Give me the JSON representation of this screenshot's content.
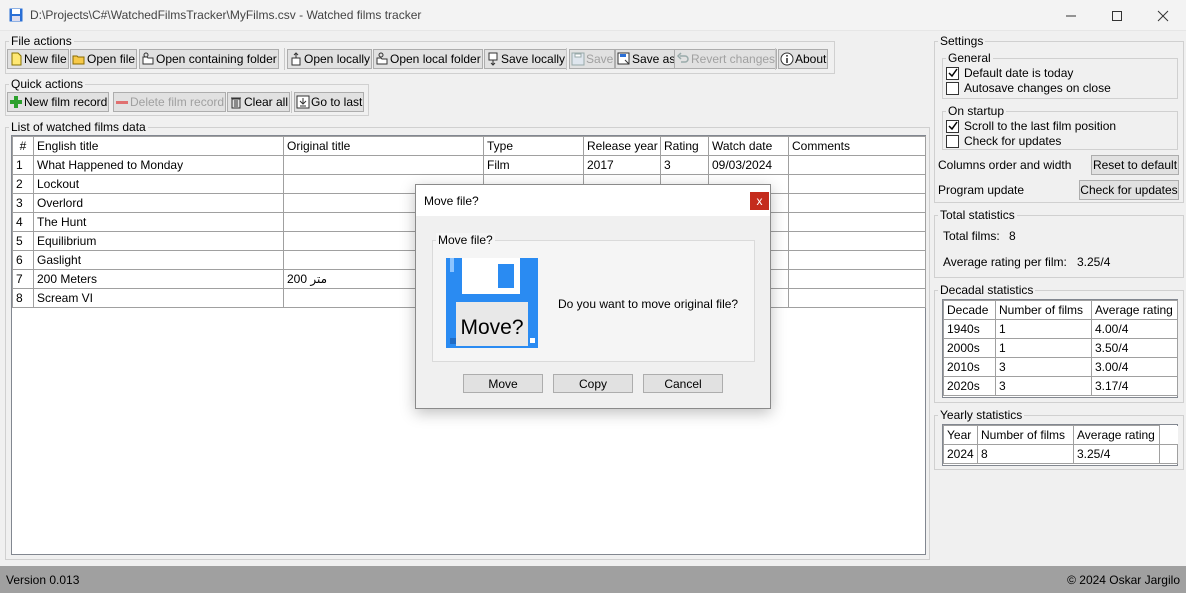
{
  "window": {
    "title": "D:\\Projects\\C#\\WatchedFilmsTracker\\MyFilms.csv - Watched films tracker"
  },
  "file_actions": {
    "label": "File actions",
    "buttons": [
      {
        "label": "New file",
        "icon": "new-file-icon",
        "enabled": true
      },
      {
        "label": "Open file",
        "icon": "open-folder-icon",
        "enabled": true
      },
      {
        "label": "Open containing folder",
        "icon": "containing-folder-icon",
        "enabled": true
      },
      {
        "label": "Open locally",
        "icon": "open-local-icon",
        "enabled": true
      },
      {
        "label": "Open local folder",
        "icon": "local-folder-icon",
        "enabled": true
      },
      {
        "label": "Save locally",
        "icon": "save-local-icon",
        "enabled": true
      },
      {
        "label": "Save",
        "icon": "floppy-disk-icon",
        "enabled": false
      },
      {
        "label": "Save as",
        "icon": "save-as-icon",
        "enabled": true
      },
      {
        "label": "Revert changes",
        "icon": "revert-icon",
        "enabled": false
      },
      {
        "label": "About",
        "icon": "info-icon",
        "enabled": true
      }
    ]
  },
  "quick_actions": {
    "label": "Quick actions",
    "buttons": [
      {
        "label": "New film record",
        "icon": "plus-icon",
        "enabled": true
      },
      {
        "label": "Delete film record",
        "icon": "minus-icon",
        "enabled": false
      },
      {
        "label": "Clear all",
        "icon": "trash-icon",
        "enabled": true
      },
      {
        "label": "Go to last",
        "icon": "go-to-last-icon",
        "enabled": true
      }
    ]
  },
  "films": {
    "label": "List of watched films data",
    "columns": [
      "#",
      "English title",
      "Original title",
      "Type",
      "Release year",
      "Rating",
      "Watch date",
      "Comments"
    ],
    "rows": [
      [
        "1",
        "What Happened to Monday",
        "",
        "Film",
        "2017",
        "3",
        "09/03/2024",
        ""
      ],
      [
        "2",
        "Lockout",
        "",
        "",
        "",
        "",
        "",
        ""
      ],
      [
        "3",
        "Overlord",
        "",
        "",
        "",
        "",
        "",
        ""
      ],
      [
        "4",
        "The Hunt",
        "",
        "",
        "",
        "",
        "",
        ""
      ],
      [
        "5",
        "Equilibrium",
        "",
        "",
        "",
        "",
        "",
        ""
      ],
      [
        "6",
        "Gaslight",
        "",
        "",
        "",
        "",
        "",
        ""
      ],
      [
        "7",
        "200 Meters",
        "200 متر",
        "",
        "",
        "",
        "",
        ""
      ],
      [
        "8",
        "Scream VI",
        "",
        "",
        "",
        "",
        "",
        ""
      ]
    ]
  },
  "settings": {
    "label": "Settings",
    "general": {
      "label": "General",
      "default_date": {
        "label": "Default date is today",
        "checked": true
      },
      "autosave": {
        "label": "Autosave changes on close",
        "checked": false
      }
    },
    "startup": {
      "label": "On startup",
      "scroll": {
        "label": "Scroll to the last film position",
        "checked": true
      },
      "check_updates": {
        "label": "Check for updates",
        "checked": false
      }
    },
    "columns_label": "Columns order and width",
    "reset_button": "Reset to default",
    "update_label": "Program update",
    "update_button": "Check for updates"
  },
  "total_statistics": {
    "label": "Total statistics",
    "total_films_label": "Total films:",
    "total_films_value": "8",
    "avg_rating_label": "Average rating per film:",
    "avg_rating_value": "3.25/4"
  },
  "decadal_statistics": {
    "label": "Decadal statistics",
    "columns": [
      "Decade",
      "Number of films",
      "Average rating"
    ],
    "rows": [
      [
        "1940s",
        "1",
        "4.00/4"
      ],
      [
        "2000s",
        "1",
        "3.50/4"
      ],
      [
        "2010s",
        "3",
        "3.00/4"
      ],
      [
        "2020s",
        "3",
        "3.17/4"
      ]
    ]
  },
  "yearly_statistics": {
    "label": "Yearly statistics",
    "columns": [
      "Year",
      "Number of films",
      "Average rating"
    ],
    "rows": [
      [
        "2024",
        "8",
        "3.25/4"
      ]
    ]
  },
  "status": {
    "version": "Version 0.013",
    "copyright": "© 2024 Oskar Jargilo"
  },
  "dialog": {
    "title": "Move file?",
    "group_label": "Move file?",
    "image_text": "Move?",
    "message": "Do you want to move original file?",
    "close_label": "x",
    "buttons": {
      "move": "Move",
      "copy": "Copy",
      "cancel": "Cancel"
    }
  },
  "colors": {
    "floppy_blue": "#2a8bf2",
    "close_red": "#c42b1c",
    "plus_green": "#2ca02c",
    "minus_red": "#e07070"
  }
}
